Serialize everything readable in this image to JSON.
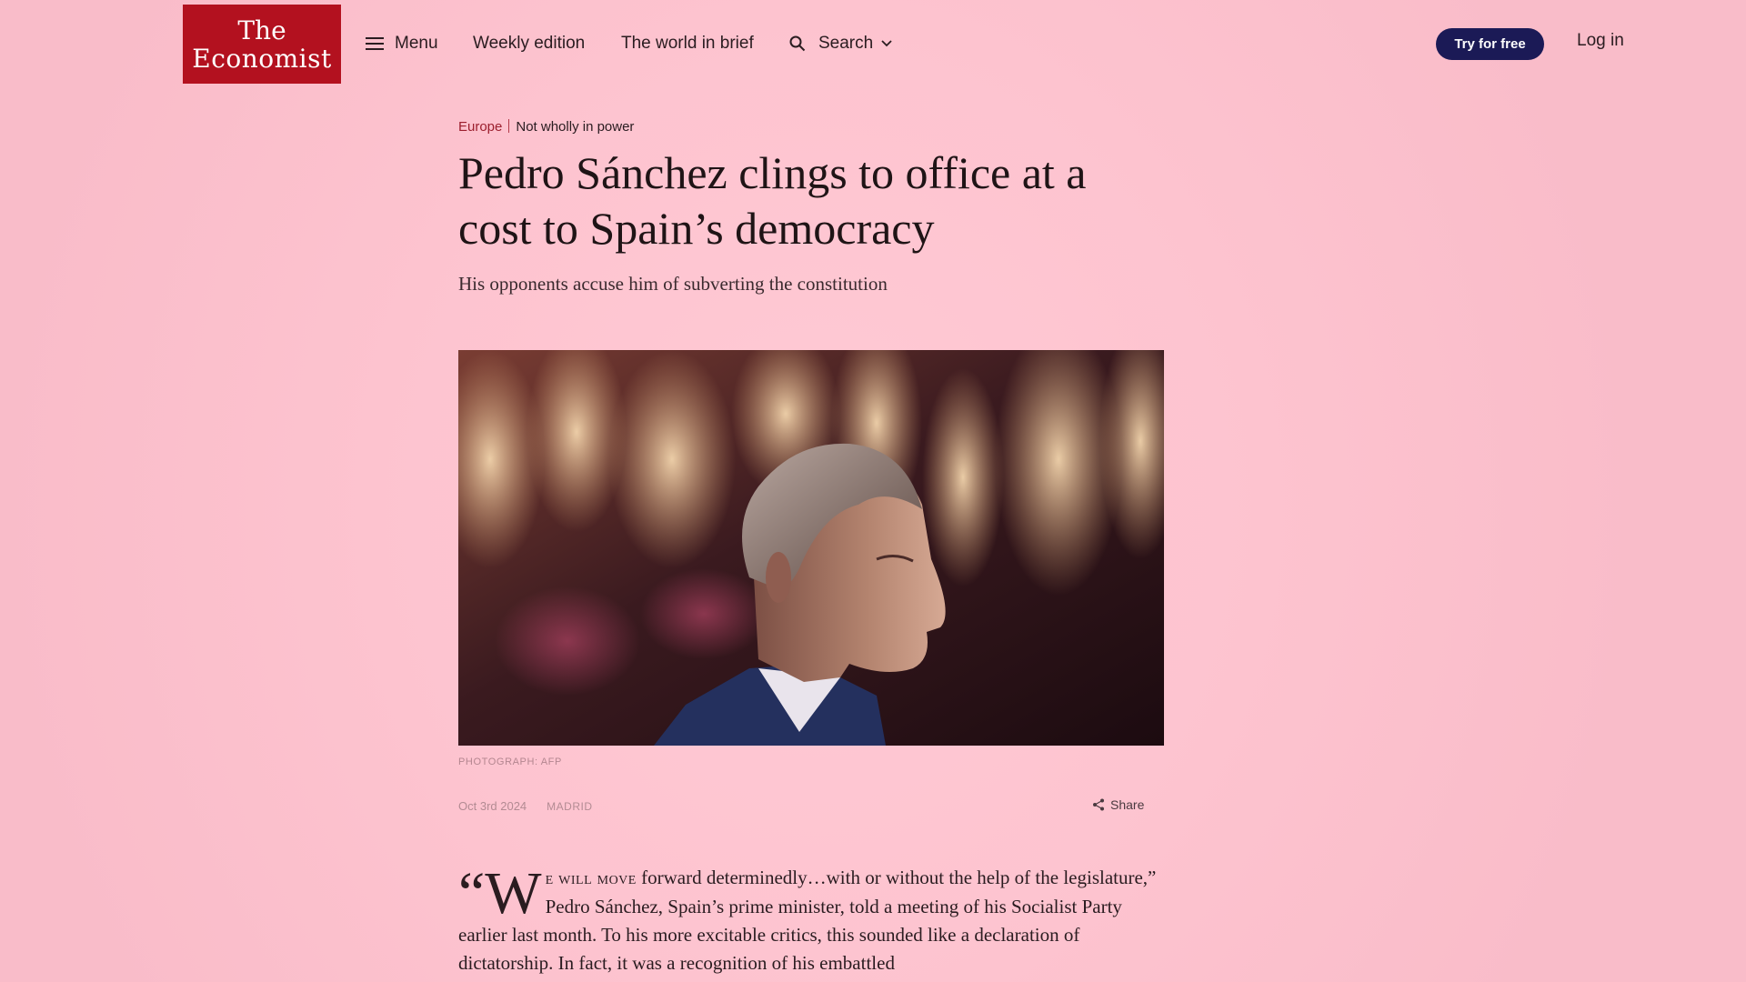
{
  "brand": {
    "logo_line1": "The",
    "logo_line2": "Economist",
    "accent": "#b3111f"
  },
  "nav": {
    "menu_label": "Menu",
    "weekly_label": "Weekly edition",
    "brief_label": "The world in brief",
    "search_label": "Search",
    "try_label": "Try for free",
    "login_label": "Log in"
  },
  "article": {
    "section": "Europe",
    "flytitle": "Not wholly in power",
    "headline": "Pedro Sánchez clings to office at a cost to Spain’s democracy",
    "standfirst": "His opponents accuse him of subverting the constitution",
    "photo_caption": "PHOTOGRAPH: AFP",
    "date": "Oct 3rd 2024",
    "dateline": "MADRID",
    "share_label": "Share",
    "body_open_quote": "“",
    "body_dropcap": "W",
    "body_smallcaps": "e will move",
    "body_rest": " forward determinedly…with or without the help of the legislature,” Pedro Sánchez, Spain’s prime minister, told a meeting of his Socialist Party earlier last month. To his more excitable critics, this sounded like a declaration of dictatorship. In fact, it was a recognition of his embattled"
  },
  "colors": {
    "button_bg": "#1b1a56",
    "page_bg": "#fdc3cf"
  }
}
